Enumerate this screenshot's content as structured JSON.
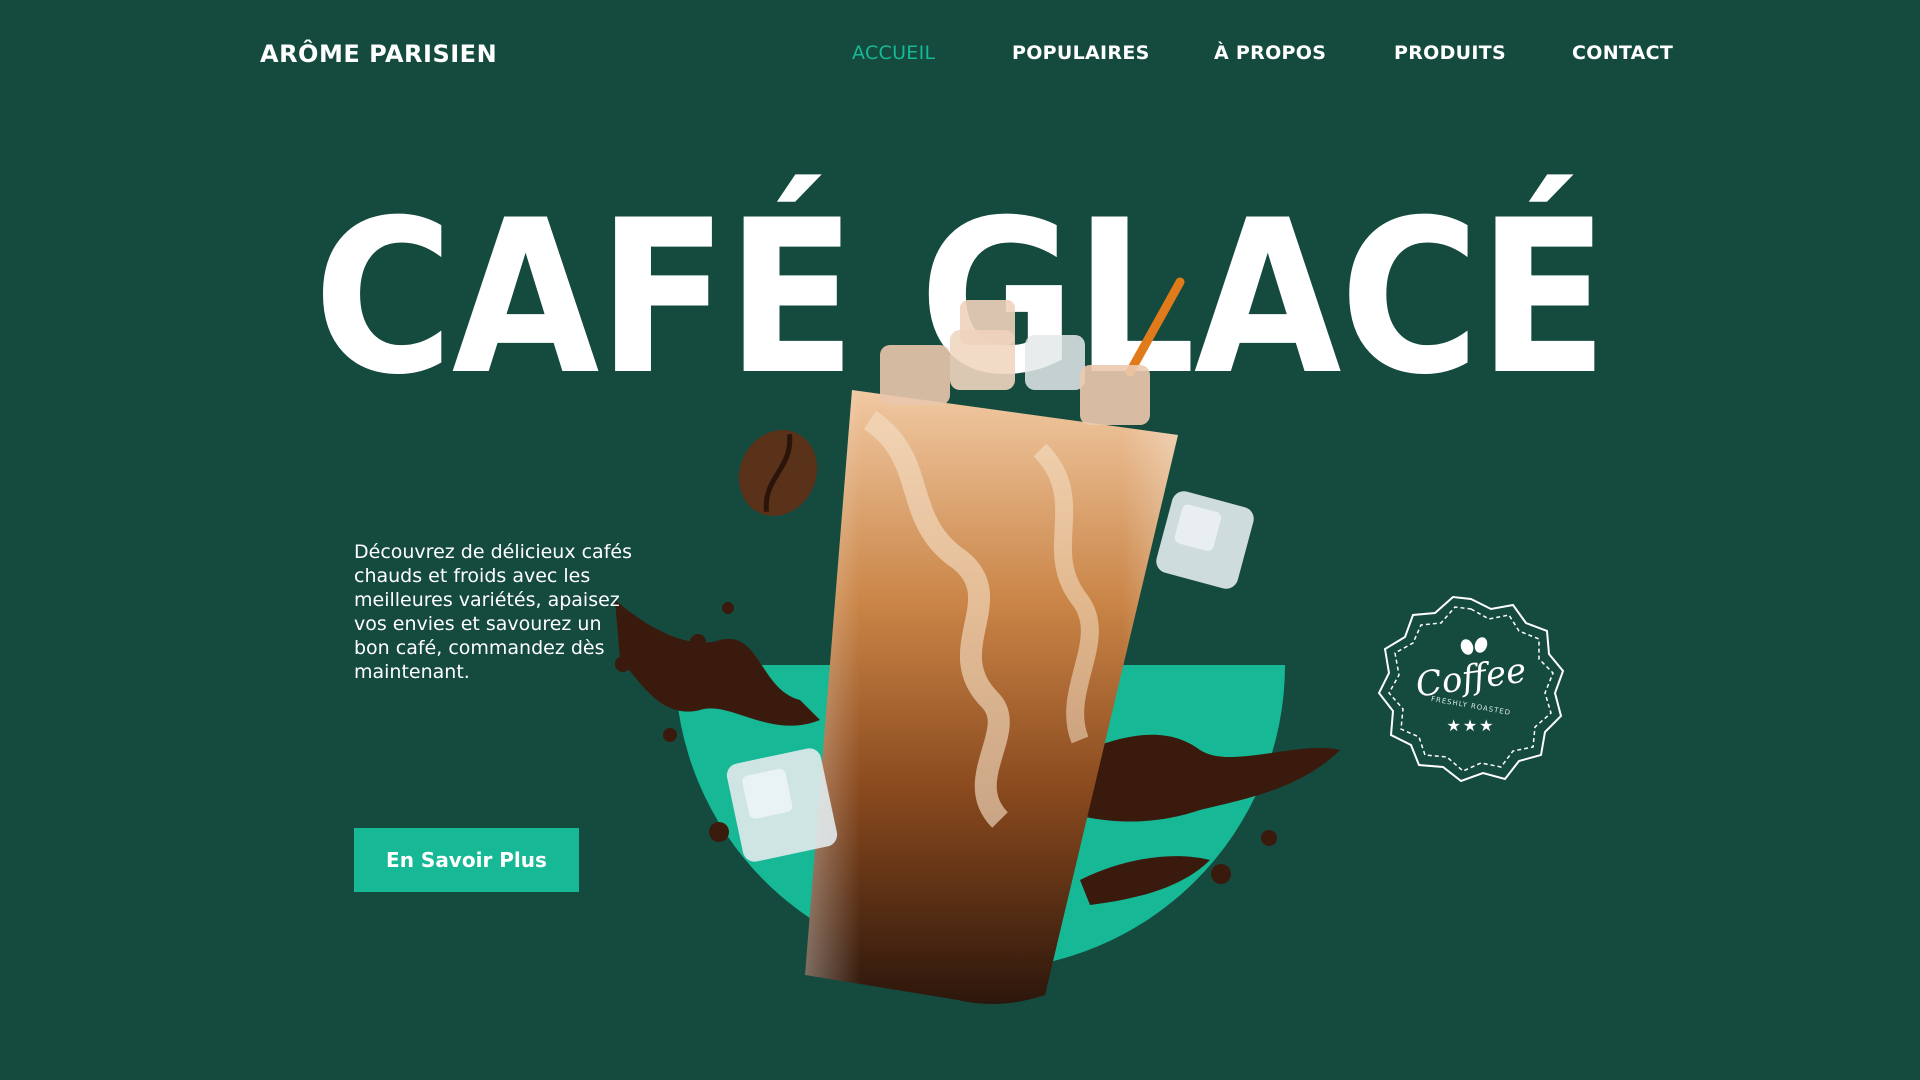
{
  "brand": {
    "name": "ARÔME PARISIEN"
  },
  "nav": {
    "items": [
      {
        "label": "ACCUEIL",
        "active": true
      },
      {
        "label": "POPULAIRES"
      },
      {
        "label": "À PROPOS"
      },
      {
        "label": "PRODUITS"
      },
      {
        "label": "CONTACT"
      }
    ]
  },
  "hero": {
    "title": "CAFÉ GLACÉ",
    "description": "Découvrez de délicieux cafés chauds et froids avec les meilleures variétés, apaisez vos envies et savourez un bon café, commandez dès maintenant.",
    "cta_label": "En Savoir Plus"
  },
  "badge": {
    "title": "Coffee",
    "subtitle": "FRESHLY ROASTED",
    "stars": "★★★"
  },
  "colors": {
    "background": "#154a3e",
    "accent": "#17b896",
    "text": "#ffffff"
  },
  "icons": [
    "coffee-bean-icon",
    "star-icon"
  ]
}
